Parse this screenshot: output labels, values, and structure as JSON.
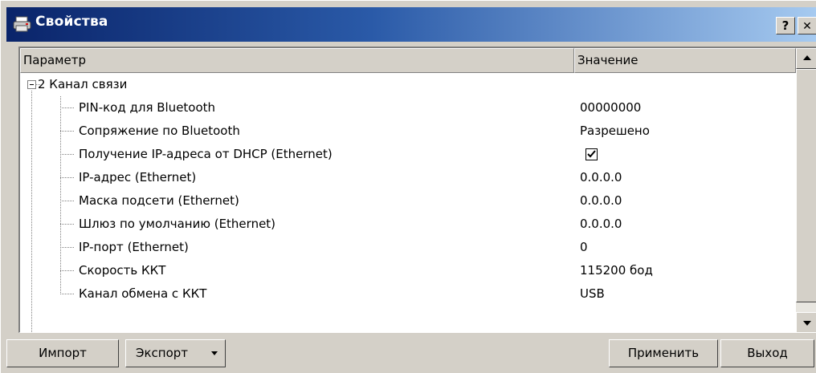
{
  "window": {
    "title": "Свойства",
    "help_label": "?",
    "close_label": "✕"
  },
  "table": {
    "col_param": "Параметр",
    "col_value": "Значение",
    "group": {
      "label": "2 Канал связи",
      "expanded": true
    },
    "rows": [
      {
        "name": "PIN-код для Bluetooth",
        "value": "00000000"
      },
      {
        "name": "Сопряжение по Bluetooth",
        "value": "Разрешено"
      },
      {
        "name": "Получение IP-адреса от DHCP (Ethernet)",
        "value": "",
        "checked": true
      },
      {
        "name": "IP-адрес (Ethernet)",
        "value": "0.0.0.0"
      },
      {
        "name": "Маска подсети (Ethernet)",
        "value": "0.0.0.0"
      },
      {
        "name": "Шлюз по умолчанию (Ethernet)",
        "value": "0.0.0.0"
      },
      {
        "name": "IP-порт (Ethernet)",
        "value": "0"
      },
      {
        "name": "Скорость ККТ",
        "value": "115200 бод"
      },
      {
        "name": "Канал обмена с ККТ",
        "value": "USB"
      }
    ]
  },
  "buttons": {
    "import": "Импорт",
    "export": "Экспорт",
    "apply": "Применить",
    "exit": "Выход"
  },
  "colors": {
    "title_start": "#0a246a",
    "title_end": "#a6caf0",
    "face": "#d4d0c8"
  }
}
